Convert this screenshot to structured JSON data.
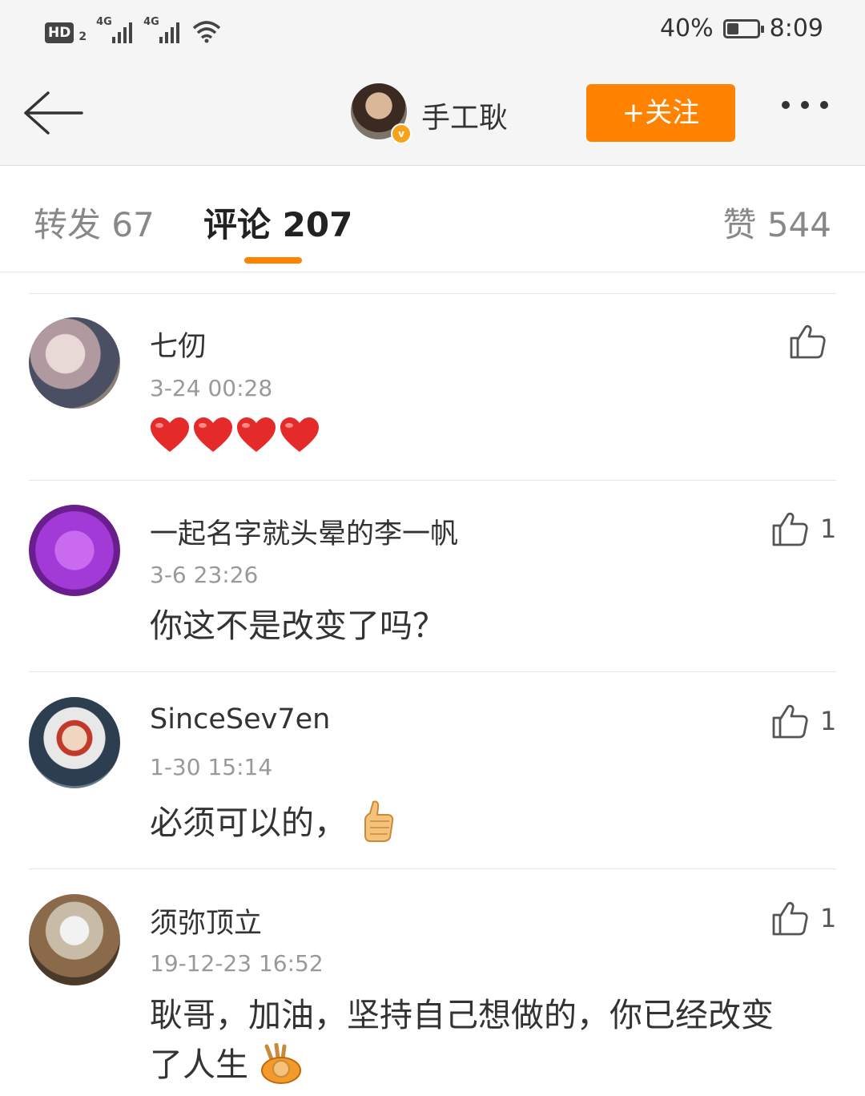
{
  "status_bar": {
    "hd_label": "HD",
    "sim_label": "2",
    "network1": "4G",
    "network2": "4G",
    "battery_percent_text": "40%",
    "battery_level": 0.4,
    "time": "8:09",
    "icons": [
      "signal-icon",
      "wifi-icon",
      "battery-icon"
    ]
  },
  "nav": {
    "username": "手工耿",
    "follow_label": "+关注",
    "verified_badge": "v",
    "accent_color": "#ff8200"
  },
  "tabs": [
    {
      "label": "转发 67"
    },
    {
      "label": "评论 207"
    },
    {
      "label": "赞 544"
    }
  ],
  "comments": [
    {
      "name": "七仞",
      "time": "3-24 00:28",
      "text": "",
      "likes": "",
      "emoji": [
        "red-heart",
        "red-heart",
        "red-heart",
        "red-heart"
      ]
    },
    {
      "name": "一起名字就头晕的李一帆",
      "time": "3-6 23:26",
      "text": "你这不是改变了吗？",
      "likes": "1"
    },
    {
      "name": "SinceSev7en",
      "time": "1-30 15:14",
      "text": "必须可以的，",
      "likes": "1",
      "emoji": [
        "thumbs-up"
      ]
    },
    {
      "name": "须弥顶立",
      "time": "19-12-23 16:52",
      "text_line1": "耿哥，加油，坚持自己想做的，你已经改变",
      "text_line2": "了人生",
      "likes": "1",
      "emoji": [
        "fist-palm"
      ]
    }
  ]
}
